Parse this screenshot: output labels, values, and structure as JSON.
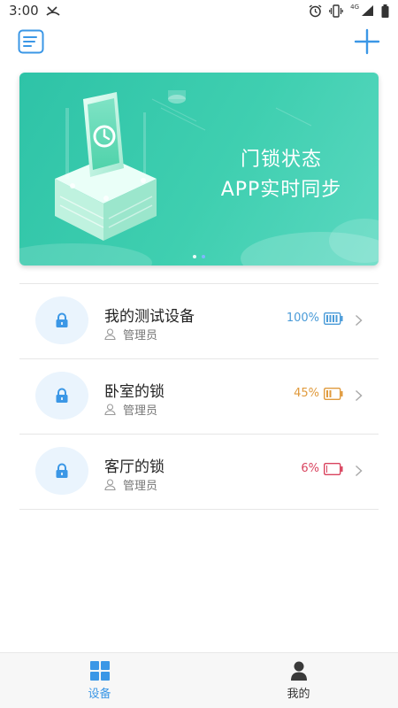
{
  "status_bar": {
    "time": "3:00",
    "network": "4G"
  },
  "banner": {
    "line1": "门锁状态",
    "line2": "APP实时同步",
    "slides": 2,
    "active_slide": 1
  },
  "devices": [
    {
      "name": "我的测试设备",
      "role": "管理员",
      "battery": "100%",
      "battery_level": 1.0,
      "battery_color": "#4a9bd8"
    },
    {
      "name": "卧室的锁",
      "role": "管理员",
      "battery": "45%",
      "battery_level": 0.45,
      "battery_color": "#e09a3c"
    },
    {
      "name": "客厅的锁",
      "role": "管理员",
      "battery": "6%",
      "battery_level": 0.06,
      "battery_color": "#d9435e"
    }
  ],
  "tabs": [
    {
      "label": "设备",
      "icon": "grid-icon",
      "active": true
    },
    {
      "label": "我的",
      "icon": "person-icon",
      "active": false
    }
  ],
  "colors": {
    "accent": "#3b97e6",
    "banner": "#36c8ab"
  }
}
